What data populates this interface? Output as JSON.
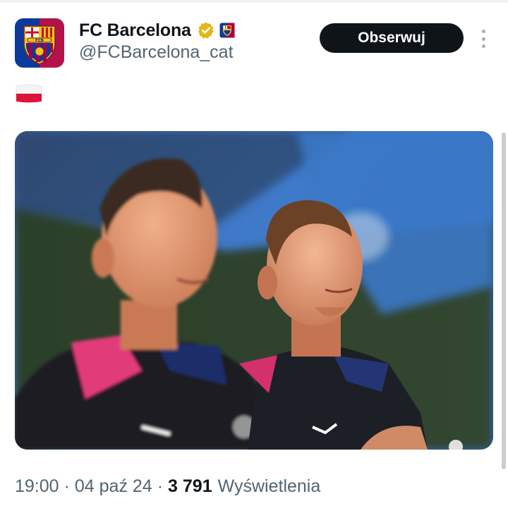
{
  "account": {
    "display_name": "FC Barcelona",
    "handle": "@FCBarcelona_cat",
    "verified": true,
    "verified_badge": "gold-verified-icon",
    "affiliate_badge": "fcb-crest-icon"
  },
  "actions": {
    "follow_label": "Obserwuj",
    "more_icon": "more-vertical-icon"
  },
  "tweet": {
    "text_icon": "poland-flag-emoji",
    "media": "photo-two-players-training"
  },
  "meta": {
    "time": "19:00",
    "separator": "·",
    "date": "04 paź 24",
    "views_count": "3 791",
    "views_label": "Wyświetlenia"
  },
  "colors": {
    "text": "#0f1419",
    "secondary_text": "#536471",
    "button_bg": "#0f1419",
    "verified_gold": "#e2b719"
  }
}
